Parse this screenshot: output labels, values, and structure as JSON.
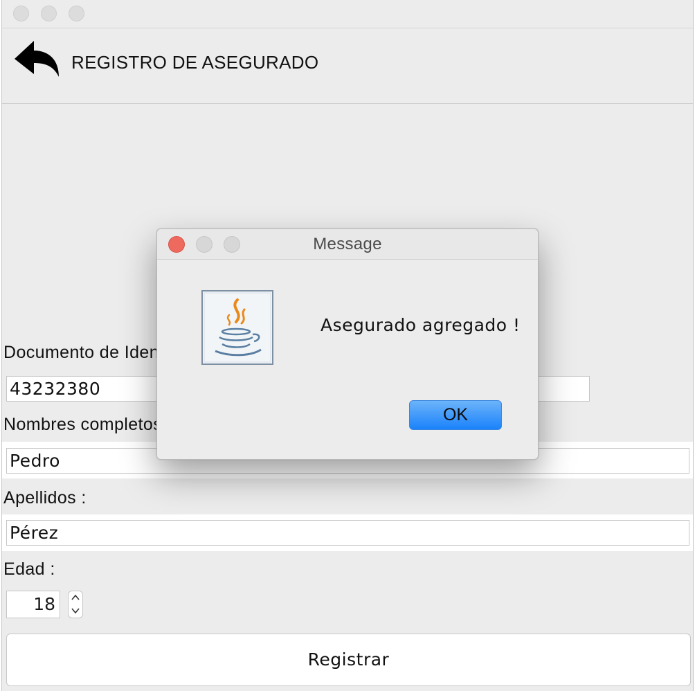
{
  "app": {
    "page_title": "REGISTRO DE ASEGURADO"
  },
  "form": {
    "document_label": "Documento de Identidad :",
    "document_value": "43232380",
    "names_label": "Nombres completos :",
    "names_value": "Pedro",
    "surnames_label": "Apellidos :",
    "surnames_value": "Pérez",
    "age_label": "Edad :",
    "age_value": "18",
    "register_label": "Registrar"
  },
  "dialog": {
    "title": "Message",
    "message": "Asegurado agregado !",
    "ok_label": "OK"
  },
  "colors": {
    "window_bg": "#ececec",
    "close_red": "#ee6a5f",
    "ok_blue": "#1a82fb"
  },
  "icons": {
    "back": "back-arrow-icon",
    "dialog": "java-icon"
  }
}
